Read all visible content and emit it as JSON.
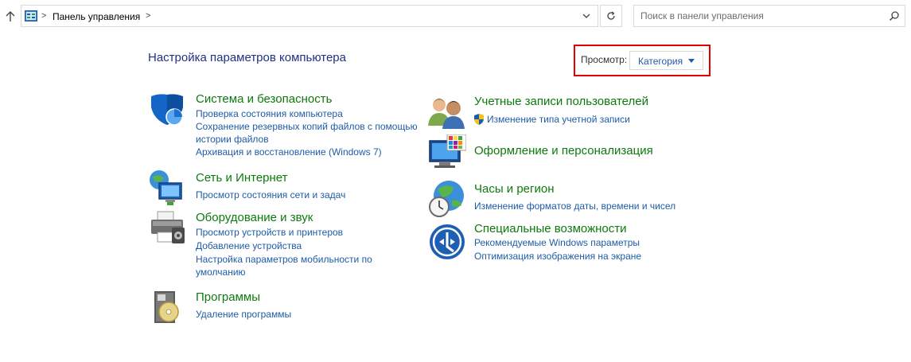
{
  "address_bar": {
    "breadcrumb": "Панель управления",
    "separator": ">"
  },
  "search": {
    "placeholder": "Поиск в панели управления"
  },
  "header": {
    "title": "Настройка параметров компьютера",
    "view_label": "Просмотр:",
    "view_value": "Категория"
  },
  "categories": {
    "system": {
      "title": "Система и безопасность",
      "links": [
        "Проверка состояния компьютера",
        "Сохранение резервных копий файлов с помощью истории файлов",
        "Архивация и восстановление (Windows 7)"
      ]
    },
    "network": {
      "title": "Сеть и Интернет",
      "links": [
        "Просмотр состояния сети и задач"
      ]
    },
    "hardware": {
      "title": "Оборудование и звук",
      "links": [
        "Просмотр устройств и принтеров",
        "Добавление устройства",
        "Настройка параметров мобильности по умолчанию"
      ]
    },
    "programs": {
      "title": "Программы",
      "links": [
        "Удаление программы"
      ]
    },
    "accounts": {
      "title": "Учетные записи пользователей",
      "links": [
        "Изменение типа учетной записи"
      ]
    },
    "appearance": {
      "title": "Оформление и персонализация",
      "links": []
    },
    "clock": {
      "title": "Часы и регион",
      "links": [
        "Изменение форматов даты, времени и чисел"
      ]
    },
    "ease": {
      "title": "Специальные возможности",
      "links": [
        "Рекомендуемые Windows параметры",
        "Оптимизация изображения на экране"
      ]
    }
  },
  "icons": {
    "up": "arrow-up-icon",
    "control_panel": "control-panel-icon",
    "dropdown": "chevron-down-icon",
    "refresh": "refresh-icon",
    "search": "search-icon",
    "shield": "uac-shield-icon"
  },
  "colors": {
    "title_blue": "#1e3287",
    "link_blue": "#1e5ca8",
    "category_green": "#0e7a0e",
    "highlight_red": "#e00000",
    "border_gray": "#d9d9d9"
  }
}
